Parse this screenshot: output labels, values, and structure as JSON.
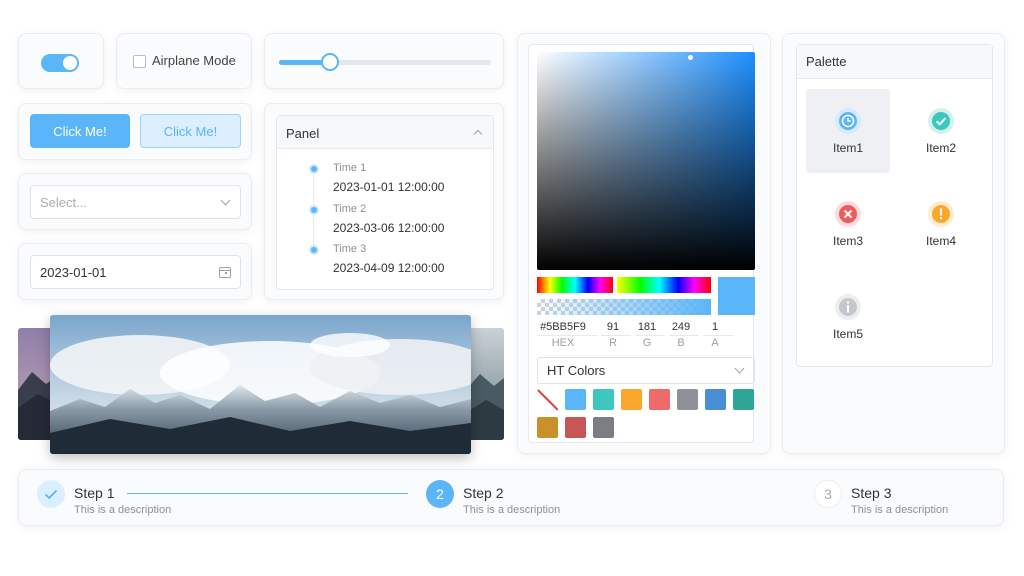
{
  "toggle": {
    "on": true
  },
  "checkbox": {
    "label": "Airplane Mode",
    "checked": false
  },
  "slider": {
    "value": 0.24
  },
  "buttons": {
    "primary_label": "Click Me!",
    "secondary_label": "Click Me!"
  },
  "select": {
    "placeholder": "Select..."
  },
  "date": {
    "value": "2023-01-01"
  },
  "panel": {
    "title": "Panel",
    "timeline": [
      {
        "title": "Time 1",
        "time": "2023-01-01 12:00:00"
      },
      {
        "title": "Time 2",
        "time": "2023-03-06 12:00:00"
      },
      {
        "title": "Time 3",
        "time": "2023-04-09 12:00:00"
      }
    ]
  },
  "color_picker": {
    "hex": "#5BB5F9",
    "r": "91",
    "g": "181",
    "b": "249",
    "a": "1",
    "labels": {
      "hex": "HEX",
      "r": "R",
      "g": "G",
      "b": "B",
      "a": "A"
    },
    "preset_set": "HT Colors",
    "swatches": [
      "#5bb5f9",
      "#3dc7be",
      "#fba72e",
      "#ef6b6b",
      "#8e9197",
      "#4a8fd4",
      "#2fa596",
      "#c8912a",
      "#c85656",
      "#7b7e84"
    ]
  },
  "palette": {
    "title": "Palette",
    "items": [
      {
        "label": "Item1",
        "icon": "clock-icon",
        "color": "#5bb5f9",
        "active": true
      },
      {
        "label": "Item2",
        "icon": "check-icon",
        "color": "#3dc7be",
        "active": false
      },
      {
        "label": "Item3",
        "icon": "x-icon",
        "color": "#ef5b5b",
        "active": false
      },
      {
        "label": "Item4",
        "icon": "exclamation-icon",
        "color": "#fba72e",
        "active": false
      },
      {
        "label": "Item5",
        "icon": "info-icon",
        "color": "#c4c7cc",
        "active": false
      }
    ]
  },
  "steps": [
    {
      "title": "Step 1",
      "desc": "This is a description",
      "state": "done"
    },
    {
      "title": "Step 2",
      "desc": "This is a description",
      "state": "active",
      "num": "2"
    },
    {
      "title": "Step 3",
      "desc": "This is a description",
      "state": "waiting",
      "num": "3"
    }
  ]
}
